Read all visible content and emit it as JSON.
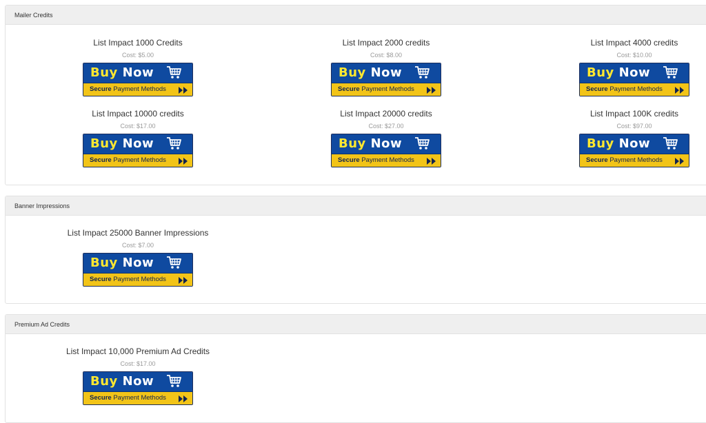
{
  "sections": [
    {
      "title": "Mailer Credits",
      "products": [
        {
          "name": "List Impact 1000 Credits",
          "cost": "Cost: $5.00"
        },
        {
          "name": "List Impact 2000 credits",
          "cost": "Cost: $8.00"
        },
        {
          "name": "List Impact 4000 credits",
          "cost": "Cost: $10.00"
        },
        {
          "name": "List Impact 10000 credits",
          "cost": "Cost: $17.00"
        },
        {
          "name": "List Impact 20000 credits",
          "cost": "Cost: $27.00"
        },
        {
          "name": "List Impact 100K credits",
          "cost": "Cost: $97.00"
        }
      ]
    },
    {
      "title": "Banner Impressions",
      "products": [
        {
          "name": "List Impact 25000 Banner Impressions",
          "cost": "Cost: $7.00"
        }
      ]
    },
    {
      "title": "Premium Ad Credits",
      "products": [
        {
          "name": "List Impact 10,000 Premium Ad Credits",
          "cost": "Cost: $17.00"
        }
      ]
    }
  ],
  "buy_button": {
    "buy_word": "Buy",
    "now_word": "Now",
    "secure_word": "Secure",
    "payment_text": "Payment Methods",
    "icon": "shopping-cart-icon",
    "arrow_icon": "double-arrow-right-icon",
    "colors": {
      "top": "#0f4aa0",
      "bottom": "#f2c418",
      "buy_text": "#ffe830"
    }
  }
}
